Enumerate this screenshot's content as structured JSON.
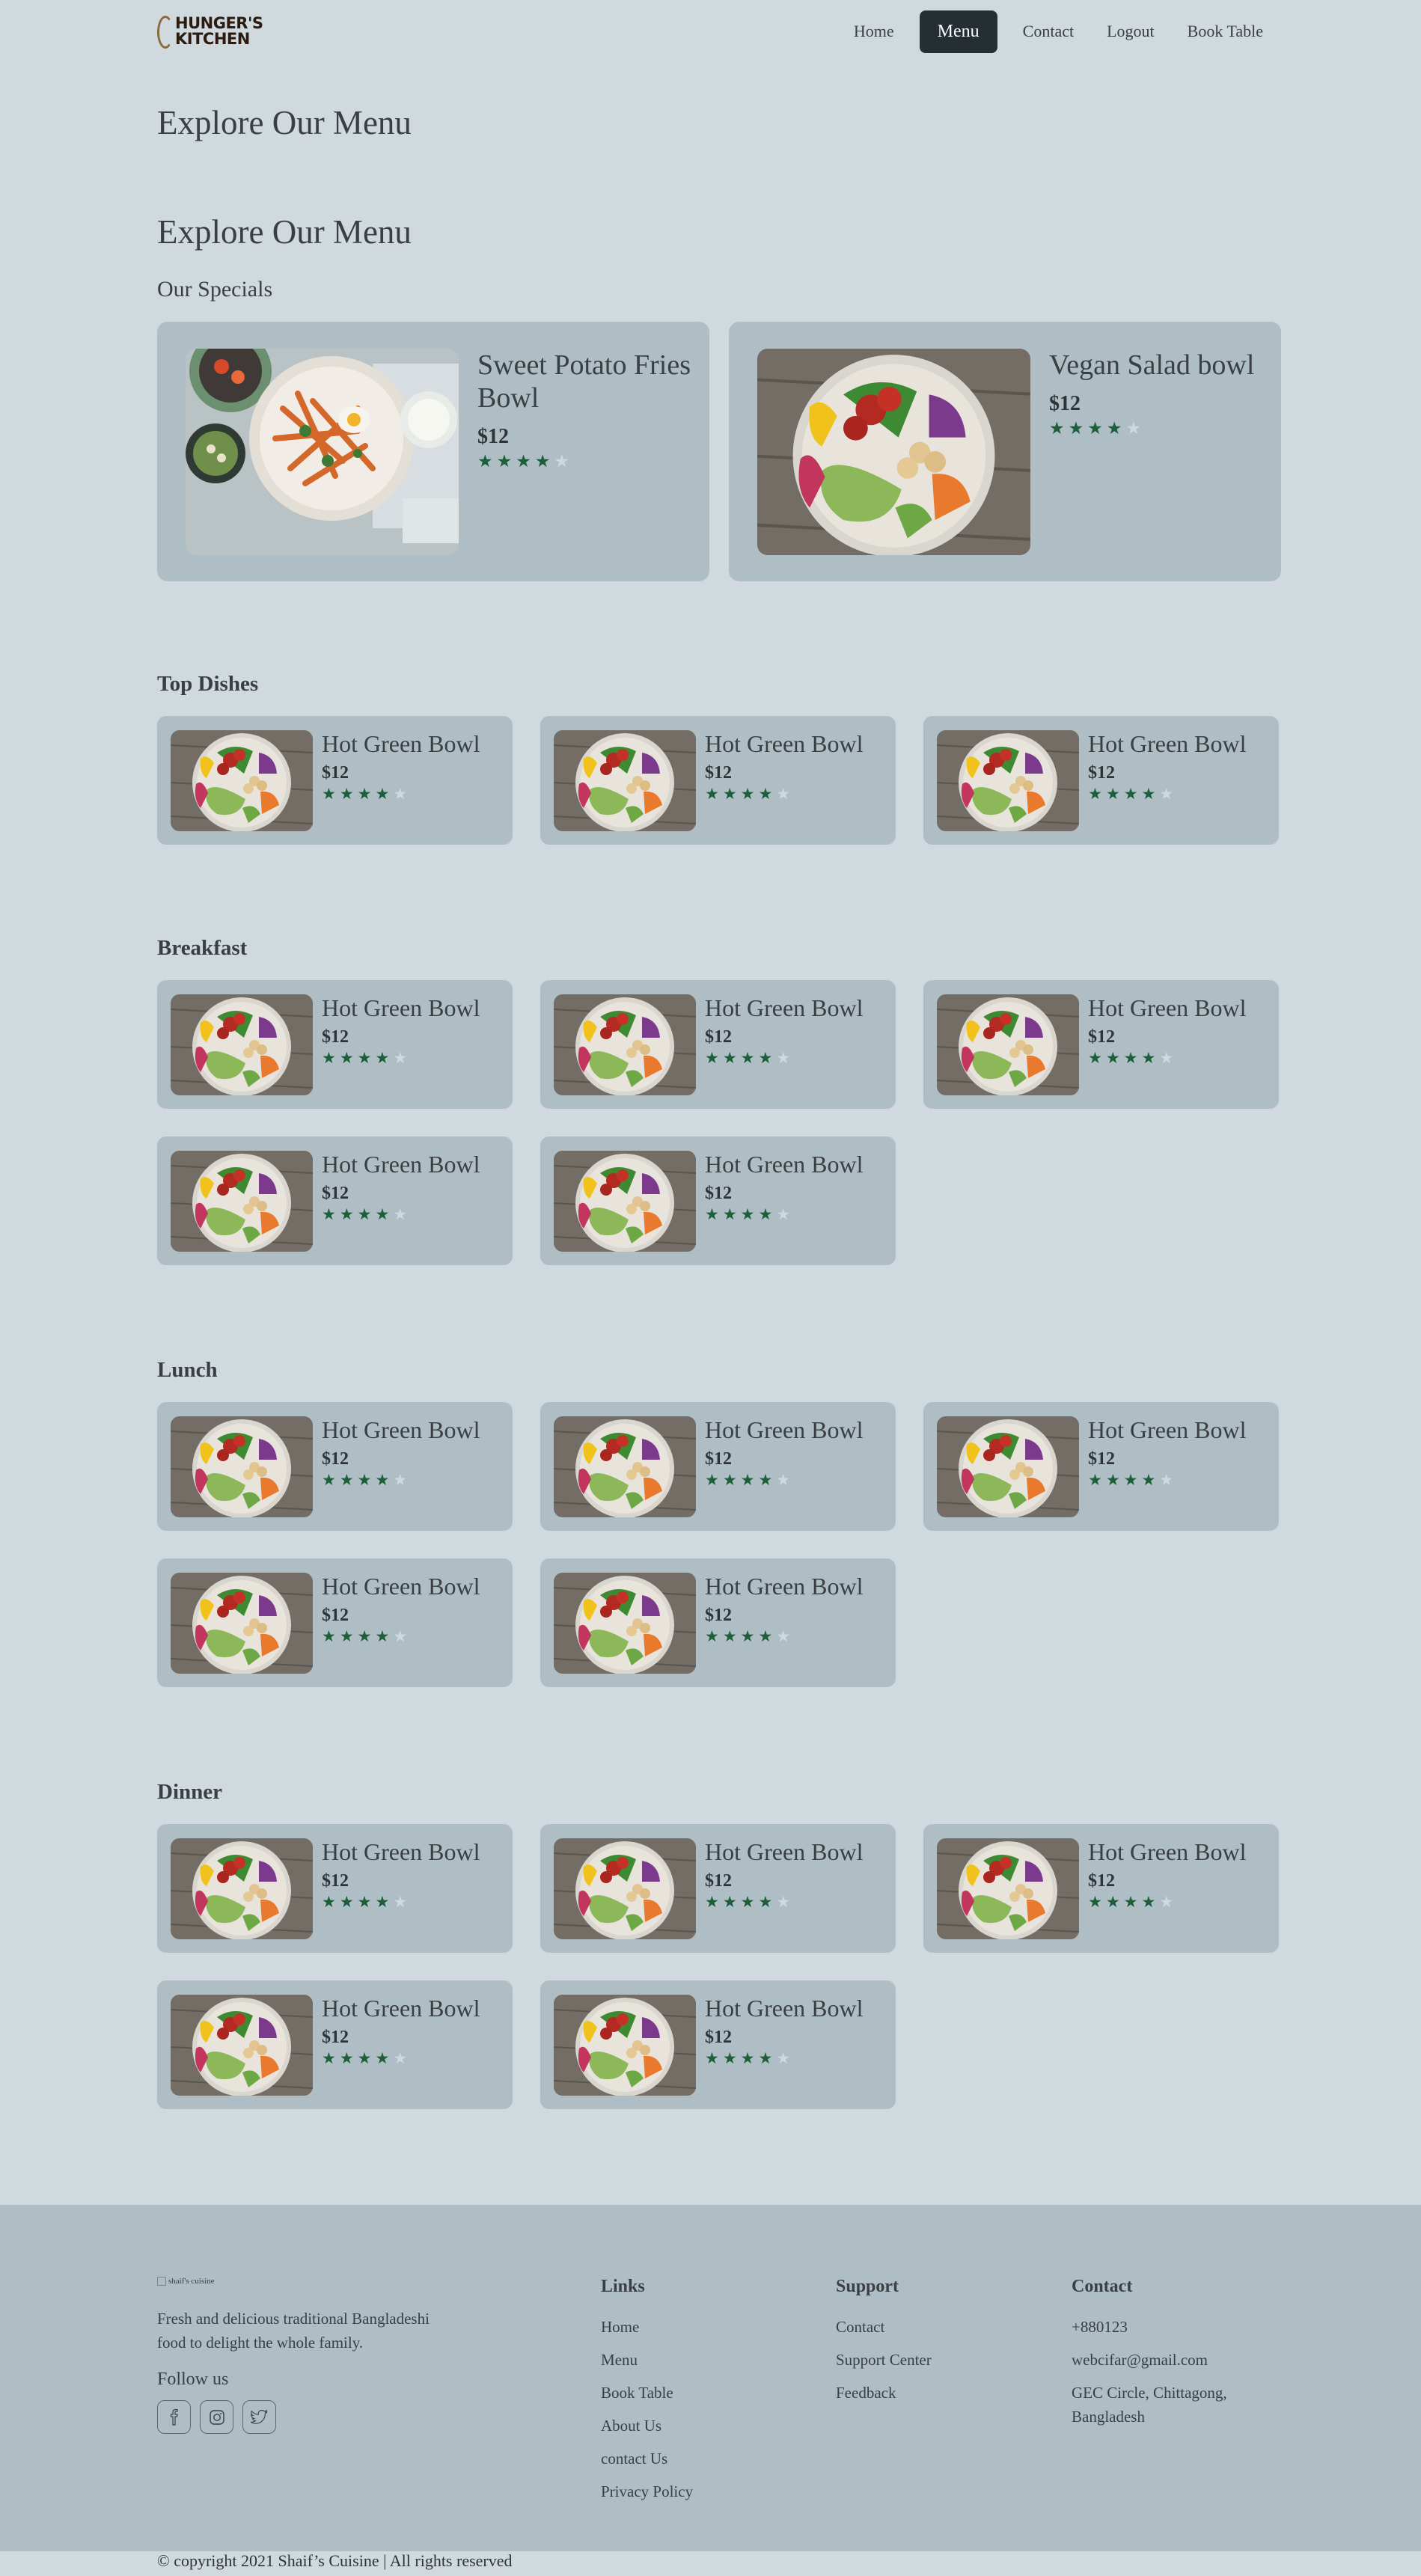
{
  "nav": {
    "logo_line1": "HUNGER'S",
    "logo_line2": "KITCHEN",
    "links": [
      "Home",
      "Menu",
      "Contact",
      "Logout",
      "Book Table"
    ],
    "active": "Menu"
  },
  "page": {
    "heading_top": "Explore Our Menu",
    "heading_main": "Explore Our Menu",
    "specials_label": "Our Specials"
  },
  "specials": [
    {
      "name": "Sweet Potato Fries Bowl",
      "price": "$12",
      "rating": 4
    },
    {
      "name": "Vegan Salad bowl",
      "price": "$12",
      "rating": 4
    }
  ],
  "sections": {
    "top_dishes": {
      "title": "Top Dishes",
      "items": [
        {
          "name": "Hot Green Bowl",
          "price": "$12",
          "rating": 4
        },
        {
          "name": "Hot Green Bowl",
          "price": "$12",
          "rating": 4
        },
        {
          "name": "Hot Green Bowl",
          "price": "$12",
          "rating": 4
        }
      ]
    },
    "breakfast": {
      "title": "Breakfast",
      "items": [
        {
          "name": "Hot Green Bowl",
          "price": "$12",
          "rating": 4
        },
        {
          "name": "Hot Green Bowl",
          "price": "$12",
          "rating": 4
        },
        {
          "name": "Hot Green Bowl",
          "price": "$12",
          "rating": 4
        },
        {
          "name": "Hot Green Bowl",
          "price": "$12",
          "rating": 4
        },
        {
          "name": "Hot Green Bowl",
          "price": "$12",
          "rating": 4
        }
      ]
    },
    "lunch": {
      "title": "Lunch",
      "items": [
        {
          "name": "Hot Green Bowl",
          "price": "$12",
          "rating": 4
        },
        {
          "name": "Hot Green Bowl",
          "price": "$12",
          "rating": 4
        },
        {
          "name": "Hot Green Bowl",
          "price": "$12",
          "rating": 4
        },
        {
          "name": "Hot Green Bowl",
          "price": "$12",
          "rating": 4
        },
        {
          "name": "Hot Green Bowl",
          "price": "$12",
          "rating": 4
        }
      ]
    },
    "dinner": {
      "title": "Dinner",
      "items": [
        {
          "name": "Hot Green Bowl",
          "price": "$12",
          "rating": 4
        },
        {
          "name": "Hot Green Bowl",
          "price": "$12",
          "rating": 4
        },
        {
          "name": "Hot Green Bowl",
          "price": "$12",
          "rating": 4
        },
        {
          "name": "Hot Green Bowl",
          "price": "$12",
          "rating": 4
        },
        {
          "name": "Hot Green Bowl",
          "price": "$12",
          "rating": 4
        }
      ]
    }
  },
  "footer": {
    "logo_alt": "shaif's cuisine",
    "tagline": "Fresh and delicious traditional Bangladeshi food to delight the whole family.",
    "follow_label": "Follow us",
    "social_icons": [
      "facebook-icon",
      "instagram-icon",
      "twitter-icon"
    ],
    "links": {
      "title": "Links",
      "items": [
        "Home",
        "Menu",
        "Book Table",
        "About Us",
        "contact Us",
        "Privacy Policy"
      ]
    },
    "support": {
      "title": "Support",
      "items": [
        "Contact",
        "Support Center",
        "Feedback"
      ]
    },
    "contact": {
      "title": "Contact",
      "phone": "+880123",
      "email": "webcifar@gmail.com",
      "address": "GEC Circle, Chittagong, Bangladesh"
    },
    "copyright": "© copyright 2021 Shaif’s Cuisine | All rights reserved"
  },
  "colors": {
    "page_bg": "#d0d9de",
    "card_bg": "#afbec5",
    "nav_active_bg": "#252f33",
    "star_on": "#1f5e3a",
    "star_off": "#cfd8dc"
  }
}
